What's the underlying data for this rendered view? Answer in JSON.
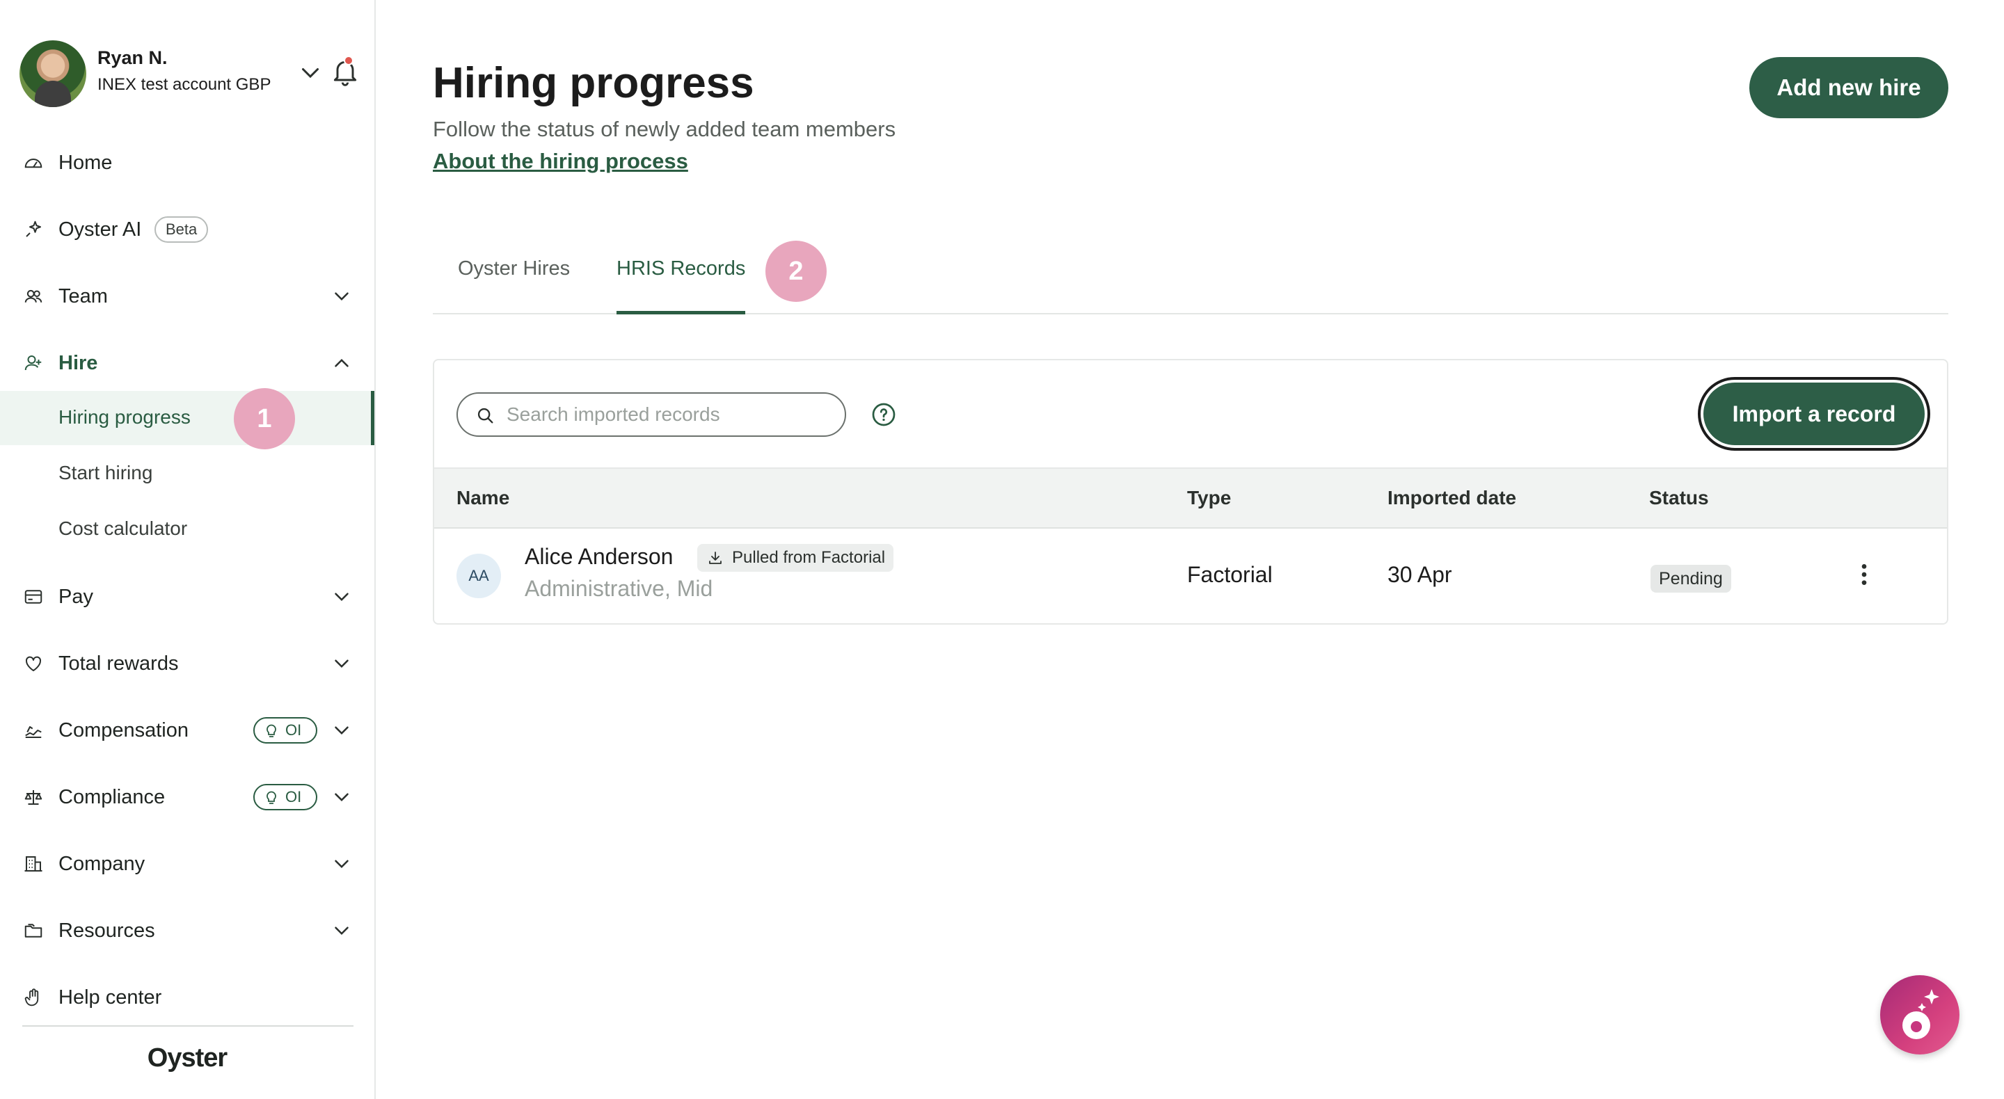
{
  "profile": {
    "name": "Ryan N.",
    "account": "INEX test account GBP"
  },
  "sidebar": {
    "items": [
      {
        "label": "Home",
        "icon": "dashboard-icon"
      },
      {
        "label": "Oyster AI",
        "badge": "Beta",
        "icon": "sparkle-icon"
      },
      {
        "label": "Team",
        "icon": "team-icon"
      },
      {
        "label": "Hire",
        "icon": "add-person-icon"
      },
      {
        "label": "Pay",
        "icon": "card-icon"
      },
      {
        "label": "Total rewards",
        "icon": "heart-icon"
      },
      {
        "label": "Compensation",
        "badge": "OI",
        "icon": "compensation-icon"
      },
      {
        "label": "Compliance",
        "badge": "OI",
        "icon": "scale-icon"
      },
      {
        "label": "Company",
        "icon": "building-icon"
      },
      {
        "label": "Resources",
        "icon": "folder-icon"
      },
      {
        "label": "Help center",
        "icon": "hand-icon"
      }
    ],
    "hire_sub": [
      "Hiring progress",
      "Start hiring",
      "Cost calculator"
    ],
    "logo": "Oyster"
  },
  "markers": [
    "1",
    "2"
  ],
  "header": {
    "title": "Hiring progress",
    "subtitle": "Follow the status of newly added team members",
    "about_link": "About the hiring process",
    "add_button": "Add new hire"
  },
  "tabs": [
    "Oyster Hires",
    "HRIS Records"
  ],
  "records": {
    "search_placeholder": "Search imported records",
    "import_button": "Import a record",
    "columns": [
      "Name",
      "Type",
      "Imported date",
      "Status"
    ],
    "rows": [
      {
        "initials": "AA",
        "name": "Alice Anderson",
        "source_badge": "Pulled from Factorial",
        "role": "Administrative, Mid",
        "type": "Factorial",
        "imported_date": "30 Apr",
        "status": "Pending"
      }
    ]
  },
  "colors": {
    "brand_green": "#2d5e47",
    "marker_pink": "#e8a6bd",
    "fab_gradient_start": "#a62a76"
  }
}
